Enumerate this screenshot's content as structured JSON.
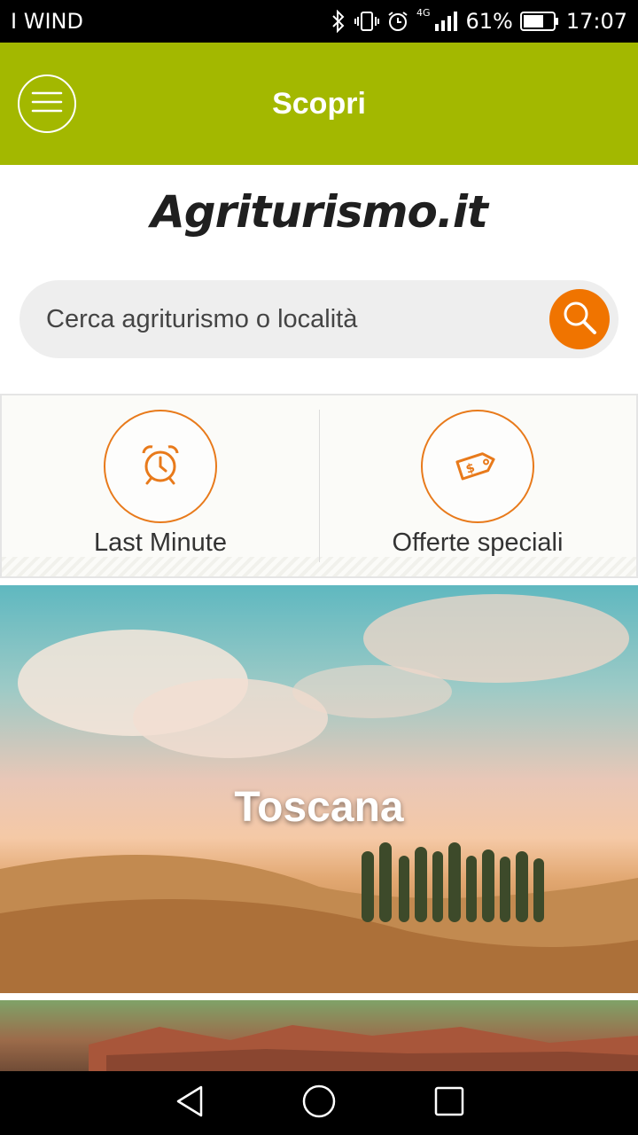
{
  "status_bar": {
    "carrier": "I WIND",
    "network": "4G",
    "battery": "61%",
    "time": "17:07"
  },
  "app_bar": {
    "title": "Scopri"
  },
  "logo": {
    "text": "Agriturismo.it"
  },
  "search": {
    "placeholder": "Cerca agriturismo o località"
  },
  "quick_links": [
    {
      "label": "Last Minute",
      "icon": "alarm-clock-icon"
    },
    {
      "label": "Offerte speciali",
      "icon": "price-tag-icon"
    }
  ],
  "regions": [
    {
      "name": "Toscana"
    },
    {
      "name": ""
    }
  ],
  "colors": {
    "app_bar": "#a3b800",
    "accent": "#f07400"
  }
}
